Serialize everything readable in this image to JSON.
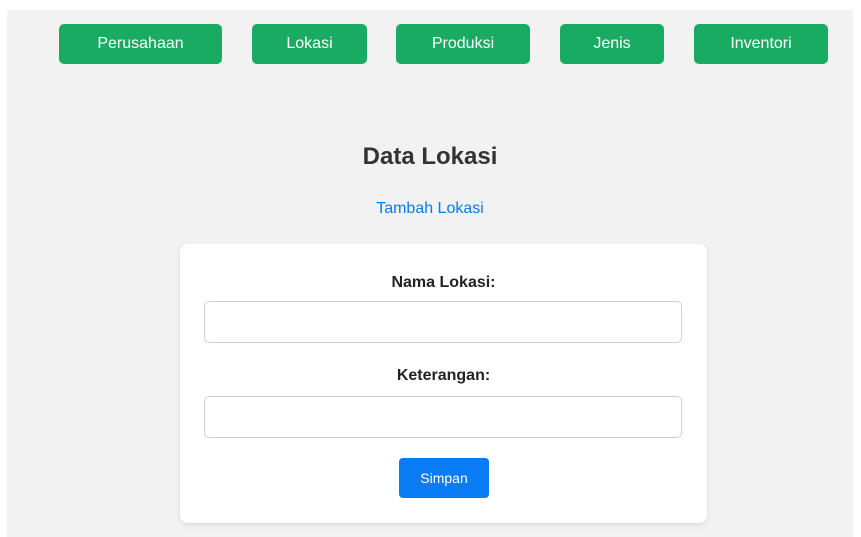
{
  "nav": {
    "items": [
      {
        "label": "Perusahaan"
      },
      {
        "label": "Lokasi"
      },
      {
        "label": "Produksi"
      },
      {
        "label": "Jenis"
      },
      {
        "label": "Inventori"
      }
    ]
  },
  "main": {
    "title": "Data Lokasi",
    "add_link": "Tambah Lokasi"
  },
  "form": {
    "nama_label": "Nama Lokasi:",
    "nama_value": "",
    "keterangan_label": "Keterangan:",
    "keterangan_value": "",
    "submit_label": "Simpan"
  },
  "colors": {
    "nav_button": "#1aab62",
    "link": "#0a7ae8",
    "submit_button": "#087cf5",
    "page_background": "#f2f2f2",
    "card_background": "#ffffff"
  }
}
